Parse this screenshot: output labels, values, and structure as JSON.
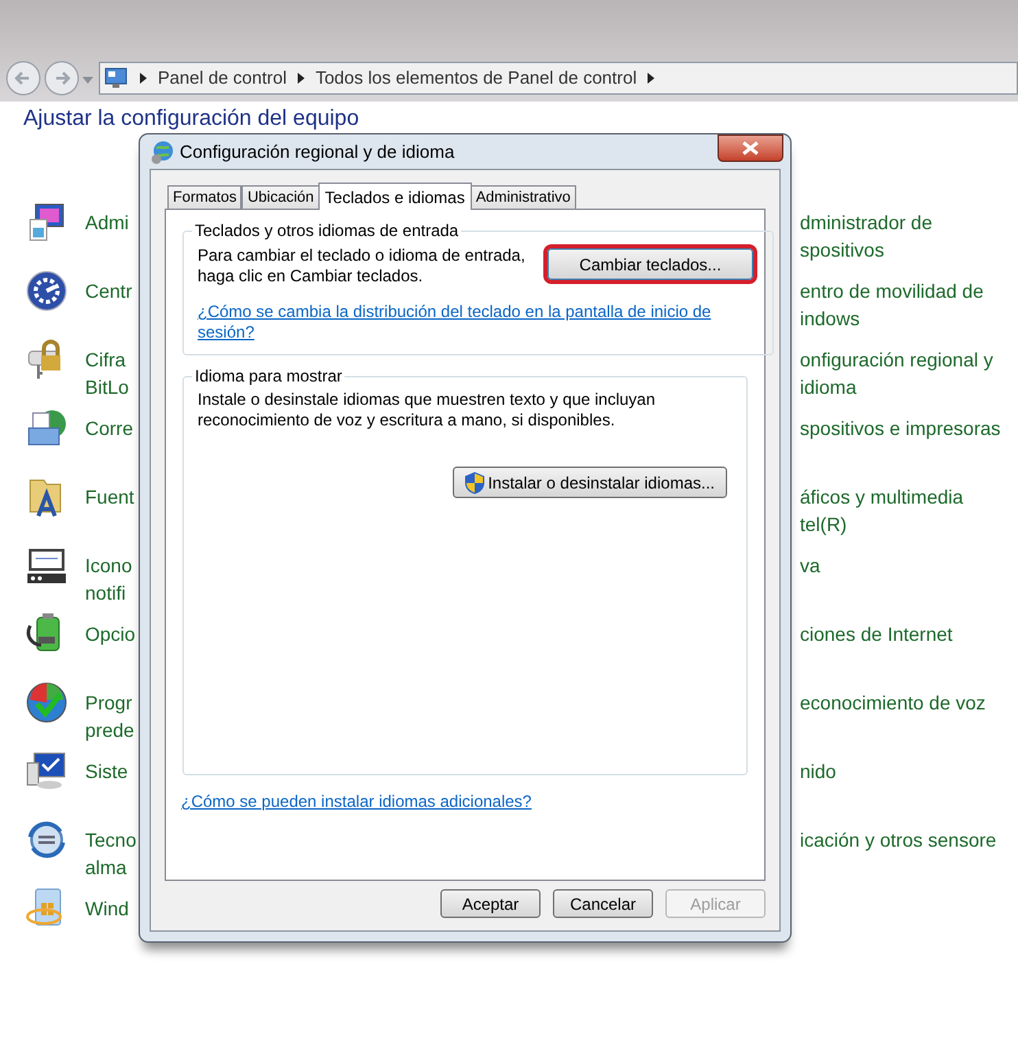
{
  "address_bar": {
    "crumbs": [
      "Panel de control",
      "Todos los elementos de Panel de control"
    ]
  },
  "heading": "Ajustar la configuración del equipo",
  "left_items": [
    {
      "kind": "monitor",
      "lines": [
        "Admi"
      ]
    },
    {
      "kind": "dial",
      "lines": [
        "Centr"
      ]
    },
    {
      "kind": "lock",
      "lines": [
        "Cifra",
        "BitLo"
      ]
    },
    {
      "kind": "mail",
      "lines": [
        "Corre"
      ]
    },
    {
      "kind": "font",
      "lines": [
        "Fuent"
      ]
    },
    {
      "kind": "tray",
      "lines": [
        "Icono",
        "notifi"
      ]
    },
    {
      "kind": "battery",
      "lines": [
        "Opcio"
      ]
    },
    {
      "kind": "programs",
      "lines": [
        "Progr",
        "prede"
      ]
    },
    {
      "kind": "system",
      "lines": [
        "Siste"
      ]
    },
    {
      "kind": "sync",
      "lines": [
        "Tecno",
        "alma"
      ]
    },
    {
      "kind": "update",
      "lines": [
        "Wind"
      ]
    }
  ],
  "right_items": [
    {
      "lines": [
        "dministrador de",
        "spositivos"
      ]
    },
    {
      "lines": [
        "entro de movilidad de",
        "indows"
      ]
    },
    {
      "lines": [
        "onfiguración regional y",
        "idioma"
      ]
    },
    {
      "lines": [
        "spositivos e impresoras"
      ]
    },
    {
      "lines": [
        "áficos y multimedia",
        "tel(R)"
      ]
    },
    {
      "lines": [
        "va"
      ]
    },
    {
      "lines": [
        "ciones de Internet"
      ]
    },
    {
      "lines": [
        "econocimiento de voz"
      ]
    },
    {
      "lines": [
        "nido"
      ]
    },
    {
      "lines": [
        "icación y otros sensore"
      ]
    }
  ],
  "dialog": {
    "title": "Configuración regional y de idioma",
    "tabs": [
      {
        "label": "Formatos",
        "selected": false
      },
      {
        "label": "Ubicación",
        "selected": false
      },
      {
        "label": "Teclados e idiomas",
        "selected": true
      },
      {
        "label": "Administrativo",
        "selected": false
      }
    ],
    "groups": [
      {
        "legend": "Teclados y otros idiomas de entrada",
        "text": "Para cambiar el teclado o idioma de entrada, haga clic en Cambiar teclados.",
        "button": {
          "label": "Cambiar teclados...",
          "highlighted": true,
          "shield": false
        },
        "link": "¿Cómo se cambia la distribución del teclado en la pantalla de inicio de sesión?"
      },
      {
        "legend": "Idioma para mostrar",
        "text": "Instale o desinstale idiomas que muestren texto y que incluyan reconocimiento de voz y escritura a mano, si disponibles.",
        "button": {
          "label": "Instalar o desinstalar idiomas...",
          "highlighted": false,
          "shield": true
        }
      }
    ],
    "bottom_link": "¿Cómo se pueden instalar idiomas adicionales?",
    "buttons": [
      {
        "label": "Aceptar",
        "disabled": false
      },
      {
        "label": "Cancelar",
        "disabled": false
      },
      {
        "label": "Aplicar",
        "disabled": true
      }
    ]
  }
}
